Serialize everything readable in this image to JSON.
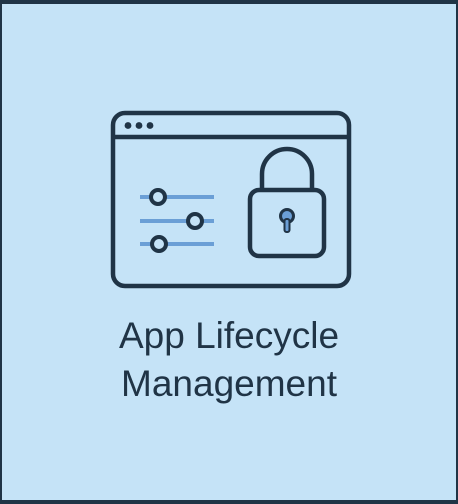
{
  "tile": {
    "title_line_1": "App Lifecycle",
    "title_line_2": "Management"
  },
  "icon": {
    "name": "app-settings-lock-icon",
    "colors": {
      "outline": "#203446",
      "accent": "#6b9fd6",
      "background": "#c5e3f7"
    }
  }
}
